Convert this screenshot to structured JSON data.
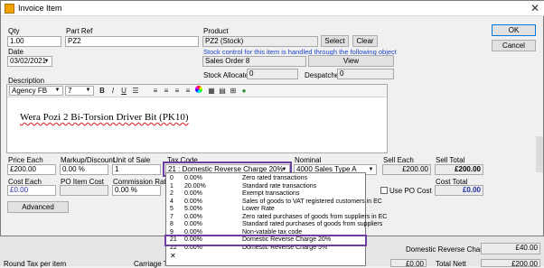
{
  "window": {
    "title": "Invoice Item"
  },
  "fields": {
    "qty_label": "Qty",
    "qty_value": "1.00",
    "partref_label": "Part Ref",
    "partref_value": "PZ2",
    "product_label": "Product",
    "product_value": "PZ2 (Stock)",
    "select_btn": "Select",
    "clear_btn": "Clear",
    "stock_note": "Stock control for this item is handled through the following object",
    "sales_order_value": "Sales Order 8",
    "view_btn": "View",
    "date_label": "Date",
    "date_value": "03/02/2021",
    "stock_allocated_label": "Stock Allocated",
    "stock_allocated_value": "0",
    "despatched_label": "Despatched",
    "despatched_value": "0",
    "description_label": "Description"
  },
  "toolbar": {
    "font": "Agency FB",
    "size": "7",
    "bold": "B",
    "italic": "I",
    "underline": "U"
  },
  "description_text": "Wera Pozi 2 Bi-Torsion Driver Bit (PK10)",
  "pricing": {
    "price_each_label": "Price Each",
    "price_each_value": "£200.00",
    "markup_label": "Markup/Discount",
    "markup_value": "0.00 %",
    "unit_label": "Unit of Sale",
    "unit_value": "1",
    "taxcode_label": "Tax Code",
    "taxcode_value": "21 : Domestic Reverse Charge 20%",
    "nominal_label": "Nominal",
    "nominal_value": "4000 Sales Type A",
    "sell_each_label": "Sell Each",
    "sell_each_value": "£200.00",
    "sell_total_label": "Sell Total",
    "sell_total_value": "£200.00",
    "cost_each_label": "Cost Each",
    "cost_each_value": "£0.00",
    "po_cost_label": "PO Item Cost",
    "commission_label": "Commission Rate",
    "commission_value": "0.00 %",
    "use_po_cost_label": "Use PO Cost",
    "cost_total_label": "Cost Total",
    "cost_total_value": "£0.00"
  },
  "buttons": {
    "ok": "OK",
    "cancel": "Cancel",
    "advanced": "Advanced"
  },
  "tax_dropdown": [
    {
      "code": "0",
      "rate": "0.00%",
      "desc": "Zero rated transactions"
    },
    {
      "code": "1",
      "rate": "20.00%",
      "desc": "Standard rate transactions"
    },
    {
      "code": "2",
      "rate": "0.00%",
      "desc": "Exempt transactions"
    },
    {
      "code": "4",
      "rate": "0.00%",
      "desc": "Sales of goods to VAT registered customers in EC"
    },
    {
      "code": "5",
      "rate": "5.00%",
      "desc": "Lower Rate"
    },
    {
      "code": "7",
      "rate": "0.00%",
      "desc": "Zero rated purchases of goods from suppliers in EC"
    },
    {
      "code": "8",
      "rate": "0.00%",
      "desc": "Standard rated purchases of goods from suppliers"
    },
    {
      "code": "9",
      "rate": "0.00%",
      "desc": "Non-vatable tax code"
    },
    {
      "code": "21",
      "rate": "0.00%",
      "desc": "Domestic Reverse Charge 20%"
    },
    {
      "code": "22",
      "rate": "0.00%",
      "desc": "Domestic Reverse Charge 5%"
    }
  ],
  "background": {
    "reverse_charge_label": "Domestic Reverse Charge",
    "reverse_charge_value": "£40.00",
    "round_tax_label": "Round Tax per item",
    "carriage_tax_label": "Carriage Tax",
    "carriage_tax_value": "£0.00",
    "total_nett_label": "Total Nett",
    "total_nett_value": "£200.00"
  },
  "colors": {
    "highlight_border": "#6a3fa0",
    "link_blue": "#1a44c8"
  }
}
